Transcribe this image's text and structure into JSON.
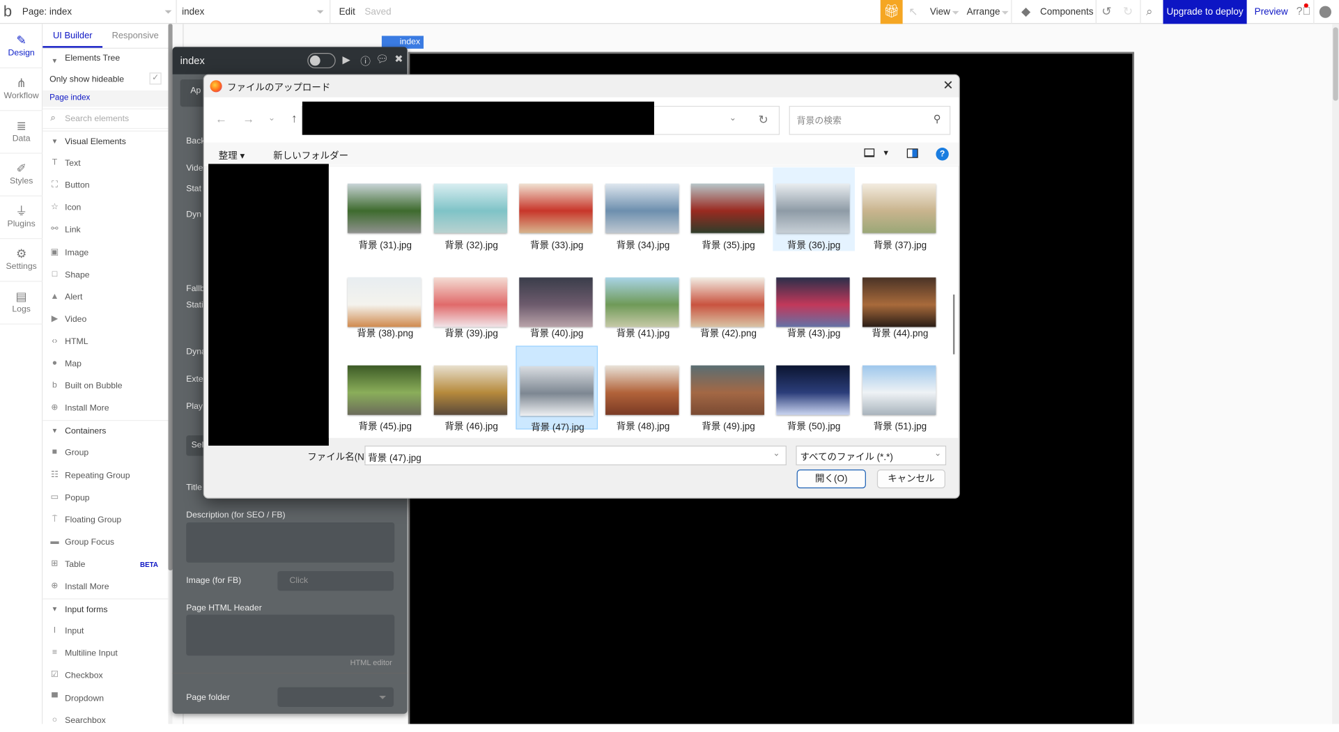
{
  "topbar": {
    "logo": "b",
    "page_select": "Page: index",
    "element_select": "index",
    "edit": "Edit",
    "saved": "Saved",
    "view": "View",
    "arrange": "Arrange",
    "components": "Components",
    "upgrade": "Upgrade to deploy",
    "preview": "Preview",
    "upgrade_color": "#0d16c4",
    "gift_color": "#f5a623"
  },
  "rail": [
    {
      "label": "Design",
      "icon": "pencil-ruler-icon",
      "glyph": "✎"
    },
    {
      "label": "Workflow",
      "icon": "sitemap-icon",
      "glyph": "⋔"
    },
    {
      "label": "Data",
      "icon": "database-icon",
      "glyph": "≣"
    },
    {
      "label": "Styles",
      "icon": "brush-icon",
      "glyph": "✐"
    },
    {
      "label": "Plugins",
      "icon": "plug-icon",
      "glyph": "⏚"
    },
    {
      "label": "Settings",
      "icon": "gear-icon",
      "glyph": "⚙"
    },
    {
      "label": "Logs",
      "icon": "document-icon",
      "glyph": "▤"
    }
  ],
  "panel": {
    "tabs": [
      "UI Builder",
      "Responsive"
    ],
    "elements_tree": "Elements Tree",
    "only_hideable": "Only show hideable",
    "page_index": "Page index",
    "search_placeholder": "Search elements",
    "items": [
      {
        "label": "Visual Elements",
        "section": true
      },
      {
        "label": "Text",
        "glyph": "T"
      },
      {
        "label": "Button",
        "glyph": "⛶"
      },
      {
        "label": "Icon",
        "glyph": "☆"
      },
      {
        "label": "Link",
        "glyph": "⚯"
      },
      {
        "label": "Image",
        "glyph": "▣"
      },
      {
        "label": "Shape",
        "glyph": "□"
      },
      {
        "label": "Alert",
        "glyph": "▲"
      },
      {
        "label": "Video",
        "glyph": "▶"
      },
      {
        "label": "HTML",
        "glyph": "‹›"
      },
      {
        "label": "Map",
        "glyph": "●"
      },
      {
        "label": "Built on Bubble",
        "glyph": "b"
      },
      {
        "label": "Install More",
        "glyph": "⊕"
      },
      {
        "label": "Containers",
        "section": true
      },
      {
        "label": "Group",
        "glyph": "■"
      },
      {
        "label": "Repeating Group",
        "glyph": "☷"
      },
      {
        "label": "Popup",
        "glyph": "▭"
      },
      {
        "label": "Floating Group",
        "glyph": "⍑"
      },
      {
        "label": "Group Focus",
        "glyph": "▬"
      },
      {
        "label": "Table",
        "glyph": "⊞",
        "badge": "BETA"
      },
      {
        "label": "Install More",
        "glyph": "⊕"
      },
      {
        "label": "Input forms",
        "section": true
      },
      {
        "label": "Input",
        "glyph": "I"
      },
      {
        "label": "Multiline Input",
        "glyph": "≡"
      },
      {
        "label": "Checkbox",
        "glyph": "☑"
      },
      {
        "label": "Dropdown",
        "glyph": "▀"
      },
      {
        "label": "Searchbox",
        "glyph": "○"
      }
    ]
  },
  "canvas": {
    "page_tag": "index"
  },
  "property_editor": {
    "title": "index",
    "tab_partial": "Ap",
    "labels_partial": [
      "Back",
      "Vide",
      "Stat",
      "Dyn",
      "Fallb",
      "Stati",
      "Dyna",
      "Exte",
      "Play"
    ],
    "select_partial": "Sel",
    "title_label": "Title",
    "description_label": "Description (for SEO / FB)",
    "image_label": "Image (for FB)",
    "image_placeholder": "Click",
    "html_header_label": "Page HTML Header",
    "html_editor_link": "HTML editor",
    "page_folder_label": "Page folder"
  },
  "dialog": {
    "title": "ファイルのアップロード",
    "search_placeholder": "背景の検索",
    "organize": "整理",
    "new_folder": "新しいフォルダー",
    "filename_label": "ファイル名(N):",
    "filename_value": "背景 (47).jpg",
    "filetype": "すべてのファイル (*.*)",
    "open": "開く(O)",
    "cancel": "キャンセル",
    "files": [
      {
        "name": "背景 (31).jpg",
        "colors": [
          "#c9d4d8",
          "#3e6b2e",
          "#8f918e"
        ]
      },
      {
        "name": "背景 (32).jpg",
        "colors": [
          "#d9eef1",
          "#7fc3c7",
          "#b9d2d0"
        ]
      },
      {
        "name": "背景 (33).jpg",
        "colors": [
          "#f0e2d2",
          "#c8362a",
          "#d7b48e"
        ]
      },
      {
        "name": "背景 (34).jpg",
        "colors": [
          "#dfe7ef",
          "#6d8fae",
          "#bfc8d1"
        ]
      },
      {
        "name": "背景 (35).jpg",
        "colors": [
          "#b7c6c9",
          "#9a2a20",
          "#2e3d2a"
        ]
      },
      {
        "name": "背景 (36).jpg",
        "colors": [
          "#e9edf0",
          "#8e9ba6",
          "#c7cfd6"
        ],
        "state": "hover"
      },
      {
        "name": "背景 (37).jpg",
        "colors": [
          "#f3ece0",
          "#c9b48e",
          "#9aa777"
        ]
      },
      {
        "name": "背景 (38).png",
        "colors": [
          "#e8edf0",
          "#f4f3ee",
          "#d08a4e"
        ]
      },
      {
        "name": "背景 (39).jpg",
        "colors": [
          "#f4dcd3",
          "#e06a6a",
          "#f1e4e8"
        ]
      },
      {
        "name": "背景 (40).jpg",
        "colors": [
          "#3a3d4a",
          "#6d5b6d",
          "#b9a3a9"
        ]
      },
      {
        "name": "背景 (41).jpg",
        "colors": [
          "#a9d4e6",
          "#6f9a58",
          "#c6c9a7"
        ]
      },
      {
        "name": "背景 (42).png",
        "colors": [
          "#f2ede4",
          "#c9533f",
          "#d9c4a6"
        ]
      },
      {
        "name": "背景 (43).jpg",
        "colors": [
          "#2b2f4a",
          "#c2385a",
          "#6471a6"
        ]
      },
      {
        "name": "背景 (44).png",
        "colors": [
          "#4a3326",
          "#a86a3b",
          "#2a1d16"
        ]
      },
      {
        "name": "背景 (45).jpg",
        "colors": [
          "#3c5a26",
          "#8aae5a",
          "#6b6b5a"
        ]
      },
      {
        "name": "背景 (46).jpg",
        "colors": [
          "#e8e0cf",
          "#b68a3c",
          "#5a4a3a"
        ]
      },
      {
        "name": "背景 (47).jpg",
        "colors": [
          "#d9dde1",
          "#7d8792",
          "#eef0f2"
        ],
        "state": "selected"
      },
      {
        "name": "背景 (48).jpg",
        "colors": [
          "#e9e3da",
          "#b2633a",
          "#7a3a24"
        ]
      },
      {
        "name": "背景 (49).jpg",
        "colors": [
          "#5a6e73",
          "#a36845",
          "#7a4a32"
        ]
      },
      {
        "name": "背景 (50).jpg",
        "colors": [
          "#0b1530",
          "#2b3d7a",
          "#c9d4f0"
        ]
      },
      {
        "name": "背景 (51).jpg",
        "colors": [
          "#9ec7ec",
          "#eef2f5",
          "#a9b4bd"
        ]
      }
    ]
  }
}
